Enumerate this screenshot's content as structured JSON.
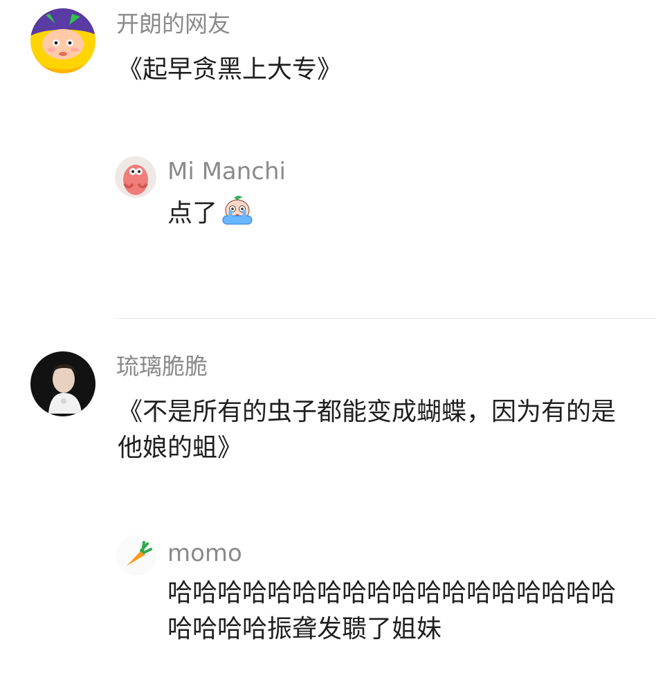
{
  "comments": [
    {
      "username": "开朗的网友",
      "text": "《起早贪黑上大专》",
      "reply": {
        "username": "Mi Manchi",
        "text": "点了",
        "emoji": "crying-emoji"
      }
    },
    {
      "username": "琉璃脆脆",
      "text": "《不是所有的虫子都能变成蝴蝶，因为有的是他娘的蛆》",
      "reply": {
        "username": "momo",
        "text": "哈哈哈哈哈哈哈哈哈哈哈哈哈哈哈哈哈哈哈哈哈哈振聋发聩了姐妹"
      }
    }
  ]
}
